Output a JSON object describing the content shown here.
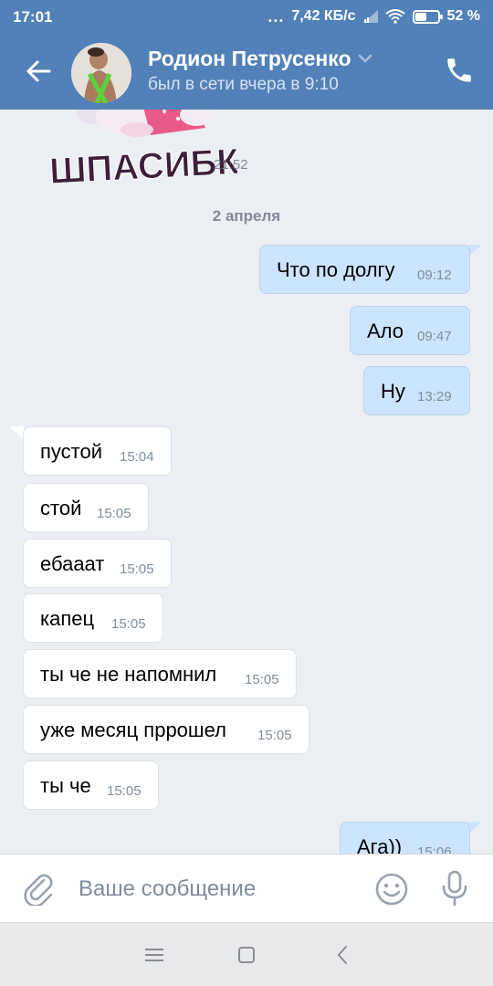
{
  "status_bar": {
    "time": "17:01",
    "dots": "...",
    "net_speed": "7,42 КБ/с",
    "battery_pct": "52 %",
    "battery_level": 0.52
  },
  "header": {
    "name": "Родион Петрусенко",
    "status": "был в сети вчера в 9:10"
  },
  "chat": {
    "sticker": {
      "text": "ШПАСИБКИ",
      "time": "21:52"
    },
    "date_separator": "2 апреля",
    "outgoing": [
      {
        "text": "Что по долгу",
        "time": "09:12"
      },
      {
        "text": "Ало",
        "time": "09:47"
      },
      {
        "text": "Ну",
        "time": "13:29"
      },
      {
        "text": "Ага))",
        "time": "15:06"
      }
    ],
    "incoming": [
      {
        "text": "пустой",
        "time": "15:04"
      },
      {
        "text": "стой",
        "time": "15:05"
      },
      {
        "text": "ебааат",
        "time": "15:05"
      },
      {
        "text": "капец",
        "time": "15:05"
      },
      {
        "text": "ты че не напомнил",
        "time": "15:05"
      },
      {
        "text": "уже месяц пррошел",
        "time": "15:05"
      },
      {
        "text": "ты че",
        "time": "15:05"
      }
    ]
  },
  "composer": {
    "placeholder": "Ваше сообщение"
  },
  "icons": {
    "back": "arrow-left-icon",
    "call": "phone-icon",
    "attach": "paperclip-icon",
    "emoji": "smile-icon",
    "voice": "mic-icon",
    "nav_menu": "menu-icon",
    "nav_home": "square-icon",
    "nav_back": "chevron-left-icon"
  },
  "colors": {
    "header": "#5181b8",
    "outgoing_bubble": "#cce4ff",
    "incoming_bubble": "#ffffff",
    "background": "#ebeef2",
    "meta_text": "#818c99"
  }
}
